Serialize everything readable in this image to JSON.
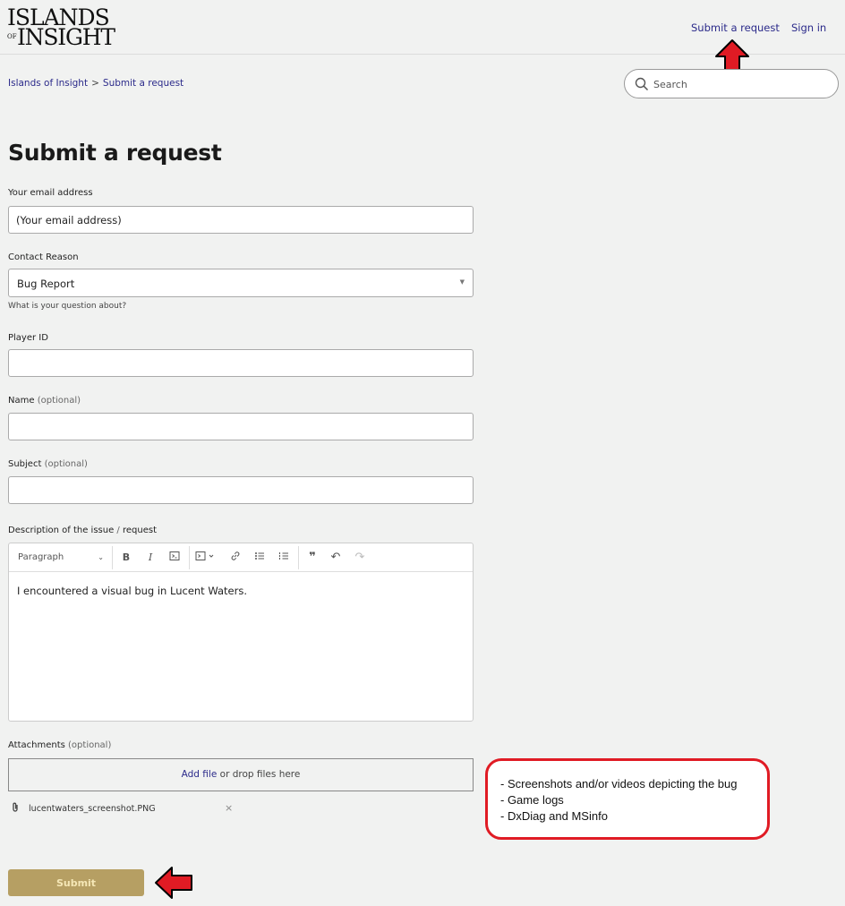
{
  "header": {
    "logo_line1": "ISLANDS",
    "logo_of": "OF",
    "logo_line2": "INSIGHT",
    "nav_submit": "Submit a request",
    "nav_signin": "Sign in"
  },
  "breadcrumb": {
    "home": "Islands of Insight",
    "separator": ">",
    "current": "Submit a request"
  },
  "search": {
    "placeholder": "Search"
  },
  "page_title": "Submit a request",
  "form": {
    "email_label": "Your email address",
    "email_value": "(Your email address)",
    "reason_label": "Contact Reason",
    "reason_value": "Bug Report",
    "reason_hint": "What is your question about?",
    "player_id_label": "Player ID",
    "name_label": "Name",
    "subject_label": "Subject",
    "optional_text": "(optional)",
    "description_label": "Description of the issue",
    "description_slash": "/",
    "description_label2": "request",
    "editor": {
      "paragraph_select": "Paragraph",
      "content": "I encountered a visual bug in Lucent Waters."
    },
    "attachments_label": "Attachments",
    "add_file": "Add file",
    "drop_text": "or drop files here",
    "file_name": "lucentwaters_screenshot.PNG",
    "remove_glyph": "×",
    "submit_label": "Submit"
  },
  "annotation": {
    "lines": [
      "- Screenshots and/or videos depicting the bug",
      "- Game logs",
      "- DxDiag and MSinfo"
    ]
  },
  "colors": {
    "link": "#2b2a8a",
    "submit_bg": "#b69f63",
    "arrow_red": "#e01b24",
    "page_bg": "#f1f2f1"
  }
}
